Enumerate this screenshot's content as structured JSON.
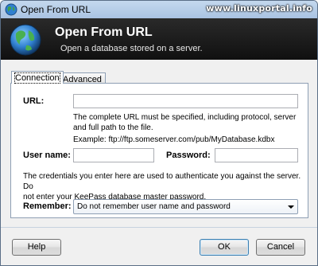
{
  "window": {
    "title": "Open From URL",
    "watermark": "www.linuxportal.info"
  },
  "banner": {
    "title": "Open From URL",
    "subtitle": "Open a database stored on a server."
  },
  "tabs": [
    {
      "label": "Connection",
      "active": true
    },
    {
      "label": "Advanced",
      "active": false
    }
  ],
  "connection": {
    "url_label": "URL:",
    "url_value": "",
    "url_help_1": "The complete URL must be specified, including protocol, server",
    "url_help_2": "and full path to the file.",
    "url_example": "Example: ftp://ftp.someserver.com/pub/MyDatabase.kdbx",
    "username_label": "User name:",
    "username_value": "",
    "password_label": "Password:",
    "password_value": "",
    "credentials_note_1": "The credentials you enter here are used to authenticate you against the server. Do",
    "credentials_note_2": "not enter your KeePass database master password.",
    "remember_label": "Remember:",
    "remember_selected": "Do not remember user name and password"
  },
  "buttons": {
    "help": "Help",
    "ok": "OK",
    "cancel": "Cancel"
  },
  "colors": {
    "banner_bg": "#151515",
    "titlebar": "#b7cde8",
    "accent_globe": "#2f7fd0"
  },
  "icons": {
    "title_icon": "globe-icon",
    "banner_icon": "globe-icon",
    "remember_dropdown": "chevron-down-icon"
  }
}
